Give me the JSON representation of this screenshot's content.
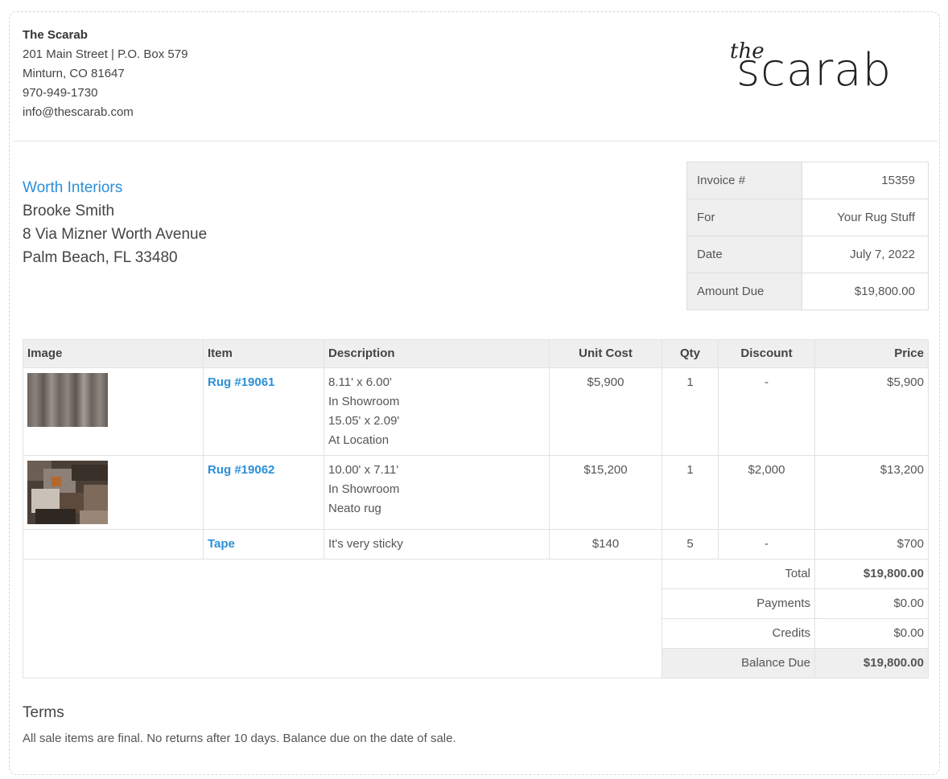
{
  "company": {
    "name": "The Scarab",
    "address1": "201 Main Street | P.O. Box 579",
    "address2": "Minturn, CO 81647",
    "phone": "970-949-1730",
    "email": "info@thescarab.com",
    "logo_small": "the",
    "logo_large": "scarab"
  },
  "client": {
    "org": "Worth Interiors",
    "contact": "Brooke Smith",
    "street": "8 Via Mizner Worth Avenue",
    "city": "Palm Beach, FL 33480"
  },
  "meta": [
    {
      "label": "Invoice #",
      "value": "15359"
    },
    {
      "label": "For",
      "value": "Your Rug Stuff"
    },
    {
      "label": "Date",
      "value": "July 7, 2022"
    },
    {
      "label": "Amount Due",
      "value": "$19,800.00"
    }
  ],
  "columns": {
    "image": "Image",
    "item": "Item",
    "description": "Description",
    "unit_cost": "Unit Cost",
    "qty": "Qty",
    "discount": "Discount",
    "price": "Price"
  },
  "rows": [
    {
      "item": "Rug #19061",
      "desc": [
        "8.11' x 6.00'",
        "In Showroom",
        "15.05' x 2.09'",
        "At Location"
      ],
      "unit_cost": "$5,900",
      "qty": "1",
      "discount": "-",
      "price": "$5,900"
    },
    {
      "item": "Rug #19062",
      "desc": [
        "10.00' x 7.11'",
        "In Showroom",
        "Neato rug"
      ],
      "unit_cost": "$15,200",
      "qty": "1",
      "discount": "$2,000",
      "price": "$13,200"
    },
    {
      "item": "Tape",
      "desc": [
        "It's very sticky"
      ],
      "unit_cost": "$140",
      "qty": "5",
      "discount": "-",
      "price": "$700"
    }
  ],
  "totals": [
    {
      "label": "Total",
      "value": "$19,800.00"
    },
    {
      "label": "Payments",
      "value": "$0.00"
    },
    {
      "label": "Credits",
      "value": "$0.00"
    },
    {
      "label": "Balance Due",
      "value": "$19,800.00"
    }
  ],
  "terms": {
    "title": "Terms",
    "text": "All sale items are final. No returns after 10 days. Balance due on the date of sale."
  },
  "colors": {
    "link": "#2b8fd8",
    "header_bg": "#efefef"
  }
}
